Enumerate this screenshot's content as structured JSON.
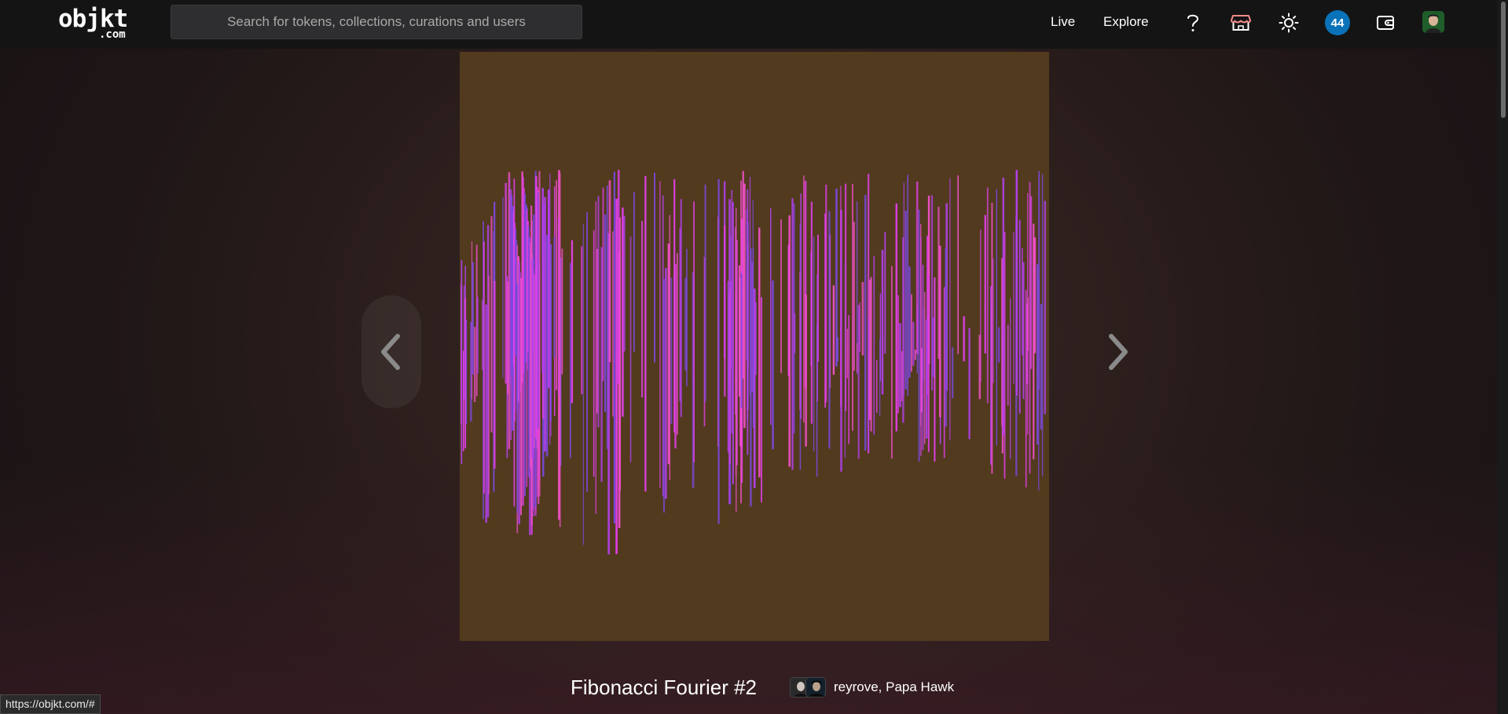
{
  "header": {
    "logo_main": "objkt",
    "logo_sub": ".com",
    "search_placeholder": "Search for tokens, collections, curations and users",
    "nav": {
      "live": "Live",
      "explore": "Explore"
    },
    "notifications_count": "44"
  },
  "icons": {
    "help": "question-mark-icon",
    "shop": "storefront-icon",
    "theme": "sun-icon",
    "wallet": "wallet-icon",
    "prev": "chevron-left-icon",
    "next": "chevron-right-icon"
  },
  "artwork": {
    "background": "#523a1e",
    "palette": [
      "#e040e8",
      "#b040e8",
      "#7a4ae0",
      "#f050c8"
    ]
  },
  "token": {
    "title": "Fibonacci Fourier #2",
    "creators": "reyrove, Papa Hawk"
  },
  "status_bar": {
    "url": "https://objkt.com/#"
  },
  "colors": {
    "accent": "#0a72b8",
    "header_bg": "#141414"
  }
}
